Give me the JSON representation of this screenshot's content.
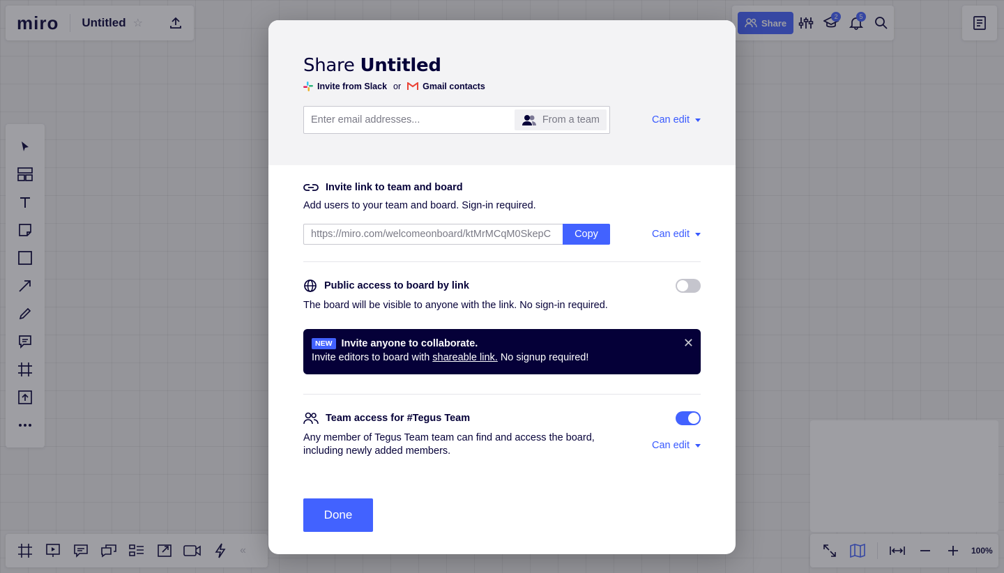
{
  "topbar": {
    "logo": "miro",
    "board_title": "Untitled",
    "share_label": "Share",
    "learn_badge": "2",
    "notifications_badge": "5"
  },
  "bottom": {
    "zoom": "100%"
  },
  "modal": {
    "title_prefix": "Share",
    "title_board": "Untitled",
    "slack_label": "Invite from Slack",
    "or_label": "or",
    "gmail_label": "Gmail contacts",
    "email_placeholder": "Enter email addresses...",
    "from_team_label": "From a team",
    "email_permission": "Can edit",
    "invite_link": {
      "title": "Invite link to team and board",
      "description": "Add users to your team and board. Sign-in required.",
      "url": "https://miro.com/welcomeonboard/ktMrMCqM0SkepC",
      "copy_label": "Copy",
      "permission": "Can edit"
    },
    "public_access": {
      "title": "Public access to board by link",
      "description": "The board will be visible to anyone with the link. No sign-in required.",
      "enabled": false
    },
    "promo": {
      "badge": "NEW",
      "headline": "Invite anyone to collaborate.",
      "text_before": "Invite editors to board with",
      "link_text": "shareable link.",
      "text_after": "No signup required!"
    },
    "team_access": {
      "title": "Team access for #Tegus Team",
      "description_line1": "Any member of Tegus Team team can find and access the board,",
      "description_line2": "including newly added members.",
      "permission": "Can edit",
      "enabled": true
    },
    "done_label": "Done"
  },
  "colors": {
    "accent": "#4262ff",
    "text": "#050038",
    "link": "#3859ff"
  }
}
